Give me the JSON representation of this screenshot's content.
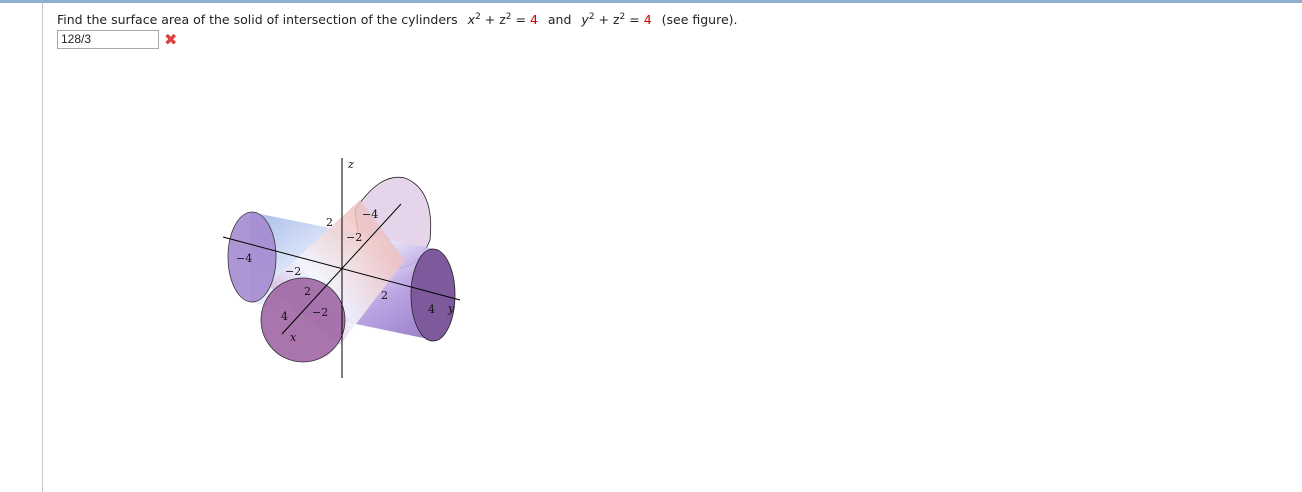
{
  "question": {
    "prefix": "Find the surface area of the solid of intersection of the cylinders",
    "eq1_lhs": "x",
    "eq1_mid": " + z",
    "eq1_eq": " = ",
    "eq1_rhs": "4",
    "conj": "and",
    "eq2_lhs": "y",
    "eq2_mid": " + z",
    "eq2_eq": " = ",
    "eq2_rhs": "4",
    "suffix": "(see figure).",
    "exp": "2"
  },
  "answer": {
    "value": "128/3",
    "status_icon": "incorrect-x-icon",
    "status_color": "#e04040"
  },
  "figure": {
    "axis_labels": {
      "x": "x",
      "y": "y",
      "z": "z"
    },
    "ticks": {
      "z_pos": "2",
      "z_neg": "−2",
      "y_neg": "−4",
      "y_neg2": "−2",
      "y_pos": "2",
      "y_pos4": "4",
      "x_pos2": "2",
      "x_pos4": "4",
      "x_neg4": "−4",
      "x_neg2": "−2"
    }
  }
}
